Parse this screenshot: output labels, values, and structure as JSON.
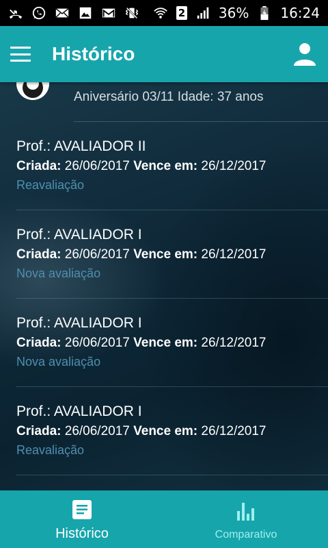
{
  "status_bar": {
    "battery": "36%",
    "time": "16:24",
    "sim": "2",
    "icons": [
      "missed-call-icon",
      "whatsapp-icon",
      "email-icon",
      "image-icon",
      "gmail-icon",
      "vibrate-icon",
      "wifi-icon",
      "sim-2-icon",
      "signal-icon",
      "battery-icon"
    ]
  },
  "app_bar": {
    "title": "Histórico",
    "menu_icon": "hamburger-menu-icon",
    "profile_icon": "person-icon"
  },
  "profile": {
    "birthday_text": "Aniversário 03/11 Idade: 37 anos"
  },
  "labels": {
    "prof_prefix": "Prof.: ",
    "created": "Criada:",
    "expires": "Vence em:"
  },
  "history": [
    {
      "professional": "AVALIADOR II",
      "created": "26/06/2017",
      "expires": "26/12/2017",
      "type": "Reavaliação"
    },
    {
      "professional": "AVALIADOR I",
      "created": "26/06/2017",
      "expires": "26/12/2017",
      "type": "Nova avaliação"
    },
    {
      "professional": "AVALIADOR I",
      "created": "26/06/2017",
      "expires": "26/12/2017",
      "type": "Nova avaliação"
    },
    {
      "professional": "AVALIADOR I",
      "created": "26/06/2017",
      "expires": "26/12/2017",
      "type": "Reavaliação"
    }
  ],
  "bottom_nav": {
    "tabs": [
      {
        "label": "Histórico",
        "icon": "document-icon",
        "active": true
      },
      {
        "label": "Comparativo",
        "icon": "bar-chart-icon",
        "active": false
      }
    ]
  },
  "colors": {
    "primary": "#17a5ac",
    "link": "#4f8fb0",
    "inactive_tab": "#9ff0ef"
  }
}
